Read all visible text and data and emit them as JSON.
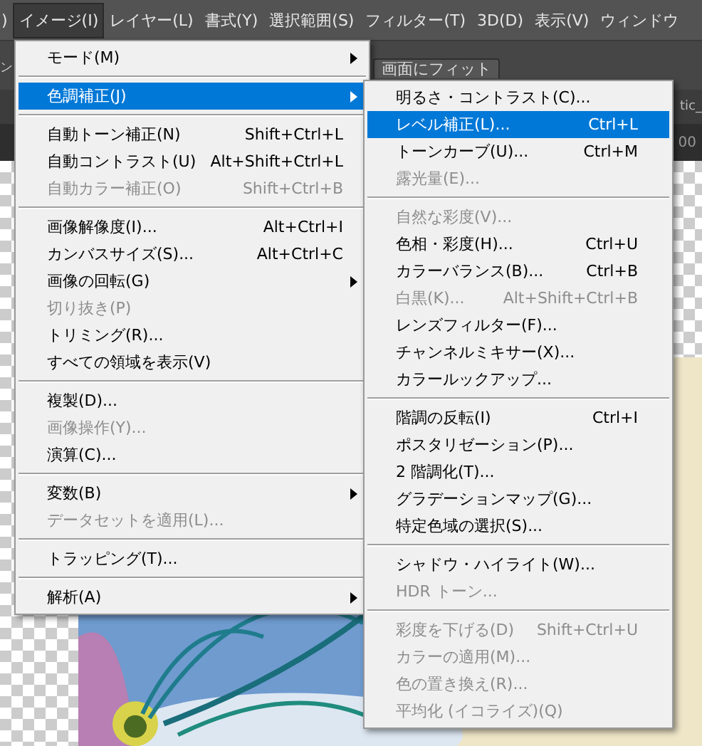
{
  "menubar": [
    {
      "label": ")",
      "selected": false
    },
    {
      "label": "イメージ(I)",
      "selected": true
    },
    {
      "label": "レイヤー(L)",
      "selected": false
    },
    {
      "label": "書式(Y)",
      "selected": false
    },
    {
      "label": "選択範囲(S)",
      "selected": false
    },
    {
      "label": "フィルター(T)",
      "selected": false
    },
    {
      "label": "3D(D)",
      "selected": false
    },
    {
      "label": "表示(V)",
      "selected": false
    },
    {
      "label": "ウィンドウ",
      "selected": false
    }
  ],
  "toolbar": {
    "left_text": "ン",
    "button": "画面にフィット"
  },
  "document_tab": {
    "title": "tic_",
    "zoom": "00"
  },
  "image_menu": [
    {
      "kind": "item",
      "label": "モード(M)",
      "disabled": false,
      "submenu": true,
      "selected": false
    },
    {
      "kind": "separator"
    },
    {
      "kind": "item",
      "label": "色調補正(J)",
      "disabled": false,
      "submenu": true,
      "selected": true
    },
    {
      "kind": "separator"
    },
    {
      "kind": "item",
      "label": "自動トーン補正(N)",
      "shortcut": "Shift+Ctrl+L",
      "disabled": false,
      "submenu": false,
      "selected": false
    },
    {
      "kind": "item",
      "label": "自動コントラスト(U)",
      "shortcut": "Alt+Shift+Ctrl+L",
      "disabled": false,
      "submenu": false,
      "selected": false
    },
    {
      "kind": "item",
      "label": "自動カラー補正(O)",
      "shortcut": "Shift+Ctrl+B",
      "disabled": true,
      "submenu": false,
      "selected": false
    },
    {
      "kind": "separator"
    },
    {
      "kind": "item",
      "label": "画像解像度(I)...",
      "shortcut": "Alt+Ctrl+I",
      "disabled": false,
      "submenu": false,
      "selected": false
    },
    {
      "kind": "item",
      "label": "カンバスサイズ(S)...",
      "shortcut": "Alt+Ctrl+C",
      "disabled": false,
      "submenu": false,
      "selected": false
    },
    {
      "kind": "item",
      "label": "画像の回転(G)",
      "disabled": false,
      "submenu": true,
      "selected": false
    },
    {
      "kind": "item",
      "label": "切り抜き(P)",
      "disabled": true,
      "submenu": false,
      "selected": false
    },
    {
      "kind": "item",
      "label": "トリミング(R)...",
      "disabled": false,
      "submenu": false,
      "selected": false
    },
    {
      "kind": "item",
      "label": "すべての領域を表示(V)",
      "disabled": false,
      "submenu": false,
      "selected": false
    },
    {
      "kind": "separator"
    },
    {
      "kind": "item",
      "label": "複製(D)...",
      "disabled": false,
      "submenu": false,
      "selected": false
    },
    {
      "kind": "item",
      "label": "画像操作(Y)...",
      "disabled": true,
      "submenu": false,
      "selected": false
    },
    {
      "kind": "item",
      "label": "演算(C)...",
      "disabled": false,
      "submenu": false,
      "selected": false
    },
    {
      "kind": "separator"
    },
    {
      "kind": "item",
      "label": "変数(B)",
      "disabled": false,
      "submenu": true,
      "selected": false
    },
    {
      "kind": "item",
      "label": "データセットを適用(L)...",
      "disabled": true,
      "submenu": false,
      "selected": false
    },
    {
      "kind": "separator"
    },
    {
      "kind": "item",
      "label": "トラッピング(T)...",
      "disabled": false,
      "submenu": false,
      "selected": false
    },
    {
      "kind": "separator"
    },
    {
      "kind": "item",
      "label": "解析(A)",
      "disabled": false,
      "submenu": true,
      "selected": false
    }
  ],
  "adjustments_menu": [
    {
      "kind": "item",
      "label": "明るさ・コントラスト(C)...",
      "disabled": false,
      "selected": false
    },
    {
      "kind": "item",
      "label": "レベル補正(L)...",
      "shortcut": "Ctrl+L",
      "disabled": false,
      "selected": true
    },
    {
      "kind": "item",
      "label": "トーンカーブ(U)...",
      "shortcut": "Ctrl+M",
      "disabled": false,
      "selected": false
    },
    {
      "kind": "item",
      "label": "露光量(E)...",
      "disabled": true,
      "selected": false
    },
    {
      "kind": "separator"
    },
    {
      "kind": "item",
      "label": "自然な彩度(V)...",
      "disabled": true,
      "selected": false
    },
    {
      "kind": "item",
      "label": "色相・彩度(H)...",
      "shortcut": "Ctrl+U",
      "disabled": false,
      "selected": false
    },
    {
      "kind": "item",
      "label": "カラーバランス(B)...",
      "shortcut": "Ctrl+B",
      "disabled": false,
      "selected": false
    },
    {
      "kind": "item",
      "label": "白黒(K)...",
      "shortcut": "Alt+Shift+Ctrl+B",
      "disabled": true,
      "selected": false
    },
    {
      "kind": "item",
      "label": "レンズフィルター(F)...",
      "disabled": false,
      "selected": false
    },
    {
      "kind": "item",
      "label": "チャンネルミキサー(X)...",
      "disabled": false,
      "selected": false
    },
    {
      "kind": "item",
      "label": "カラールックアップ...",
      "disabled": false,
      "selected": false
    },
    {
      "kind": "separator"
    },
    {
      "kind": "item",
      "label": "階調の反転(I)",
      "shortcut": "Ctrl+I",
      "disabled": false,
      "selected": false
    },
    {
      "kind": "item",
      "label": "ポスタリゼーション(P)...",
      "disabled": false,
      "selected": false
    },
    {
      "kind": "item",
      "label": "2 階調化(T)...",
      "disabled": false,
      "selected": false
    },
    {
      "kind": "item",
      "label": "グラデーションマップ(G)...",
      "disabled": false,
      "selected": false
    },
    {
      "kind": "item",
      "label": "特定色域の選択(S)...",
      "disabled": false,
      "selected": false
    },
    {
      "kind": "separator"
    },
    {
      "kind": "item",
      "label": "シャドウ・ハイライト(W)...",
      "disabled": false,
      "selected": false
    },
    {
      "kind": "item",
      "label": "HDR トーン...",
      "disabled": true,
      "selected": false
    },
    {
      "kind": "separator"
    },
    {
      "kind": "item",
      "label": "彩度を下げる(D)",
      "shortcut": "Shift+Ctrl+U",
      "disabled": true,
      "selected": false
    },
    {
      "kind": "item",
      "label": "カラーの適用(M)...",
      "disabled": true,
      "selected": false
    },
    {
      "kind": "item",
      "label": "色の置き換え(R)...",
      "disabled": true,
      "selected": false
    },
    {
      "kind": "item",
      "label": "平均化 (イコライズ)(Q)",
      "disabled": true,
      "selected": false
    }
  ]
}
